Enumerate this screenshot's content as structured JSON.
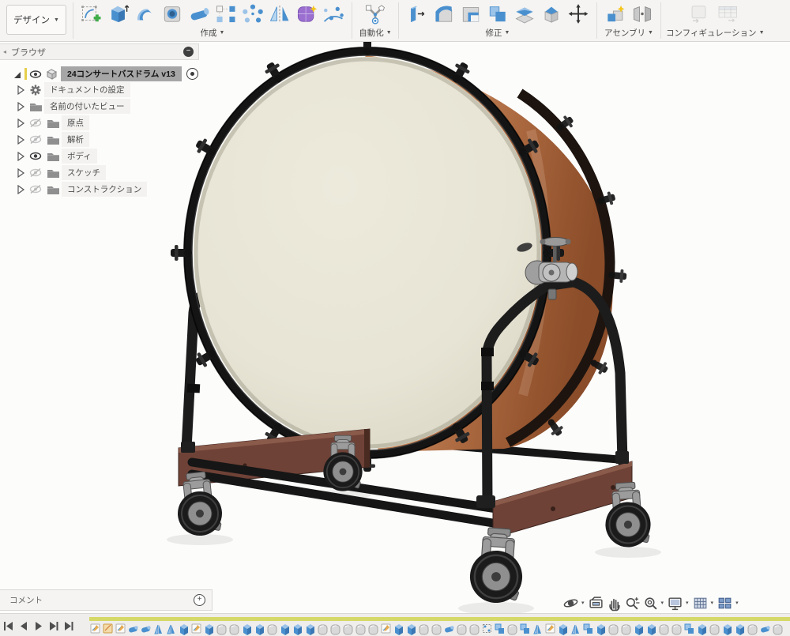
{
  "ui": {
    "caret": "▼",
    "caret_small": "▾",
    "collapse_arrow": "◂",
    "minus": "−",
    "plus": "+"
  },
  "toolbar": {
    "design_label": "デザイン",
    "groups": [
      {
        "label": "作成"
      },
      {
        "label": "自動化"
      },
      {
        "label": "修正"
      },
      {
        "label": "アセンブリ"
      },
      {
        "label": "コンフィギュレーション"
      }
    ]
  },
  "browser": {
    "title": "ブラウザ",
    "root_label": "24コンサートバスドラム v13",
    "items": [
      {
        "label": "ドキュメントの設定",
        "icon": "gear",
        "visibility": null
      },
      {
        "label": "名前の付いたビュー",
        "icon": "folder",
        "visibility": null
      },
      {
        "label": "原点",
        "icon": "folder",
        "visibility": "hidden"
      },
      {
        "label": "解析",
        "icon": "folder",
        "visibility": "hidden"
      },
      {
        "label": "ボディ",
        "icon": "folder",
        "visibility": "visible"
      },
      {
        "label": "スケッチ",
        "icon": "folder",
        "visibility": "hidden"
      },
      {
        "label": "コンストラクション",
        "icon": "folder",
        "visibility": "hidden"
      }
    ]
  },
  "comment": {
    "label": "コメント"
  },
  "nav": {
    "icons": [
      "orbit",
      "look-at",
      "pan",
      "zoom",
      "fit",
      "display-settings",
      "grid-settings",
      "viewports"
    ]
  },
  "timeline": {
    "playback": [
      "skip-to-start",
      "step-back",
      "play",
      "step-forward",
      "skip-to-end"
    ],
    "icons": [
      "sketch",
      "construct",
      "sketch",
      "pipe",
      "pipe",
      "mirror",
      "mirror",
      "box",
      "sketch",
      "box",
      "round",
      "round",
      "box",
      "box",
      "round",
      "box",
      "box",
      "box",
      "round",
      "round",
      "round",
      "round",
      "round",
      "sketch",
      "box",
      "box",
      "round",
      "round",
      "pipe",
      "round",
      "round",
      "pattern",
      "stack",
      "round",
      "stack",
      "mirror",
      "sketch",
      "box",
      "mirror",
      "stack",
      "box",
      "round",
      "round",
      "box",
      "box",
      "round",
      "round",
      "stack",
      "box",
      "round",
      "box",
      "box",
      "round",
      "pipe",
      "round"
    ]
  },
  "colors": {
    "timeline_bar": "#d5d967",
    "shell_copper": "#b06a42",
    "head_cream": "#e9e6d7",
    "rim_black": "#1a1a1a",
    "base_wood": "#6f4237"
  }
}
